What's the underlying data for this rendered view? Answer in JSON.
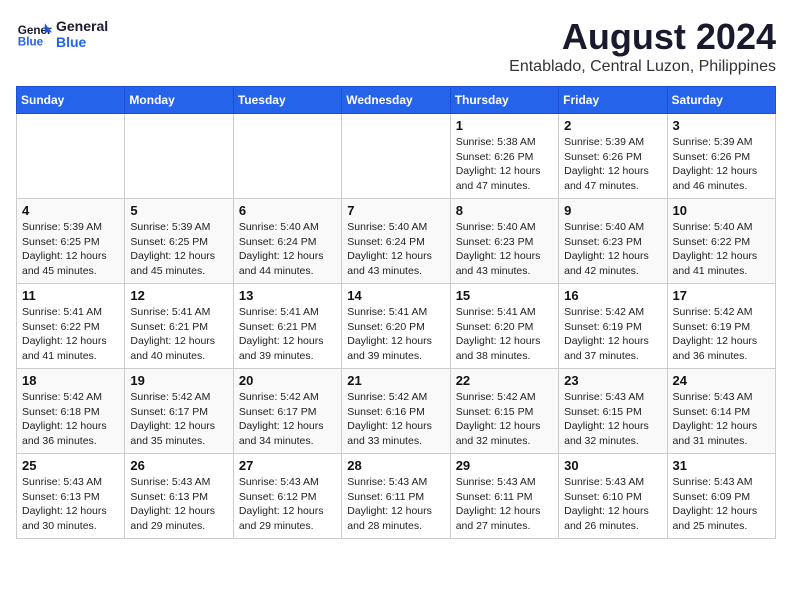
{
  "logo": {
    "text1": "General",
    "text2": "Blue"
  },
  "title": {
    "month_year": "August 2024",
    "location": "Entablado, Central Luzon, Philippines"
  },
  "weekdays": [
    "Sunday",
    "Monday",
    "Tuesday",
    "Wednesday",
    "Thursday",
    "Friday",
    "Saturday"
  ],
  "weeks": [
    [
      {
        "day": "",
        "info": ""
      },
      {
        "day": "",
        "info": ""
      },
      {
        "day": "",
        "info": ""
      },
      {
        "day": "",
        "info": ""
      },
      {
        "day": "1",
        "info": "Sunrise: 5:38 AM\nSunset: 6:26 PM\nDaylight: 12 hours\nand 47 minutes."
      },
      {
        "day": "2",
        "info": "Sunrise: 5:39 AM\nSunset: 6:26 PM\nDaylight: 12 hours\nand 47 minutes."
      },
      {
        "day": "3",
        "info": "Sunrise: 5:39 AM\nSunset: 6:26 PM\nDaylight: 12 hours\nand 46 minutes."
      }
    ],
    [
      {
        "day": "4",
        "info": "Sunrise: 5:39 AM\nSunset: 6:25 PM\nDaylight: 12 hours\nand 45 minutes."
      },
      {
        "day": "5",
        "info": "Sunrise: 5:39 AM\nSunset: 6:25 PM\nDaylight: 12 hours\nand 45 minutes."
      },
      {
        "day": "6",
        "info": "Sunrise: 5:40 AM\nSunset: 6:24 PM\nDaylight: 12 hours\nand 44 minutes."
      },
      {
        "day": "7",
        "info": "Sunrise: 5:40 AM\nSunset: 6:24 PM\nDaylight: 12 hours\nand 43 minutes."
      },
      {
        "day": "8",
        "info": "Sunrise: 5:40 AM\nSunset: 6:23 PM\nDaylight: 12 hours\nand 43 minutes."
      },
      {
        "day": "9",
        "info": "Sunrise: 5:40 AM\nSunset: 6:23 PM\nDaylight: 12 hours\nand 42 minutes."
      },
      {
        "day": "10",
        "info": "Sunrise: 5:40 AM\nSunset: 6:22 PM\nDaylight: 12 hours\nand 41 minutes."
      }
    ],
    [
      {
        "day": "11",
        "info": "Sunrise: 5:41 AM\nSunset: 6:22 PM\nDaylight: 12 hours\nand 41 minutes."
      },
      {
        "day": "12",
        "info": "Sunrise: 5:41 AM\nSunset: 6:21 PM\nDaylight: 12 hours\nand 40 minutes."
      },
      {
        "day": "13",
        "info": "Sunrise: 5:41 AM\nSunset: 6:21 PM\nDaylight: 12 hours\nand 39 minutes."
      },
      {
        "day": "14",
        "info": "Sunrise: 5:41 AM\nSunset: 6:20 PM\nDaylight: 12 hours\nand 39 minutes."
      },
      {
        "day": "15",
        "info": "Sunrise: 5:41 AM\nSunset: 6:20 PM\nDaylight: 12 hours\nand 38 minutes."
      },
      {
        "day": "16",
        "info": "Sunrise: 5:42 AM\nSunset: 6:19 PM\nDaylight: 12 hours\nand 37 minutes."
      },
      {
        "day": "17",
        "info": "Sunrise: 5:42 AM\nSunset: 6:19 PM\nDaylight: 12 hours\nand 36 minutes."
      }
    ],
    [
      {
        "day": "18",
        "info": "Sunrise: 5:42 AM\nSunset: 6:18 PM\nDaylight: 12 hours\nand 36 minutes."
      },
      {
        "day": "19",
        "info": "Sunrise: 5:42 AM\nSunset: 6:17 PM\nDaylight: 12 hours\nand 35 minutes."
      },
      {
        "day": "20",
        "info": "Sunrise: 5:42 AM\nSunset: 6:17 PM\nDaylight: 12 hours\nand 34 minutes."
      },
      {
        "day": "21",
        "info": "Sunrise: 5:42 AM\nSunset: 6:16 PM\nDaylight: 12 hours\nand 33 minutes."
      },
      {
        "day": "22",
        "info": "Sunrise: 5:42 AM\nSunset: 6:15 PM\nDaylight: 12 hours\nand 32 minutes."
      },
      {
        "day": "23",
        "info": "Sunrise: 5:43 AM\nSunset: 6:15 PM\nDaylight: 12 hours\nand 32 minutes."
      },
      {
        "day": "24",
        "info": "Sunrise: 5:43 AM\nSunset: 6:14 PM\nDaylight: 12 hours\nand 31 minutes."
      }
    ],
    [
      {
        "day": "25",
        "info": "Sunrise: 5:43 AM\nSunset: 6:13 PM\nDaylight: 12 hours\nand 30 minutes."
      },
      {
        "day": "26",
        "info": "Sunrise: 5:43 AM\nSunset: 6:13 PM\nDaylight: 12 hours\nand 29 minutes."
      },
      {
        "day": "27",
        "info": "Sunrise: 5:43 AM\nSunset: 6:12 PM\nDaylight: 12 hours\nand 29 minutes."
      },
      {
        "day": "28",
        "info": "Sunrise: 5:43 AM\nSunset: 6:11 PM\nDaylight: 12 hours\nand 28 minutes."
      },
      {
        "day": "29",
        "info": "Sunrise: 5:43 AM\nSunset: 6:11 PM\nDaylight: 12 hours\nand 27 minutes."
      },
      {
        "day": "30",
        "info": "Sunrise: 5:43 AM\nSunset: 6:10 PM\nDaylight: 12 hours\nand 26 minutes."
      },
      {
        "day": "31",
        "info": "Sunrise: 5:43 AM\nSunset: 6:09 PM\nDaylight: 12 hours\nand 25 minutes."
      }
    ]
  ]
}
